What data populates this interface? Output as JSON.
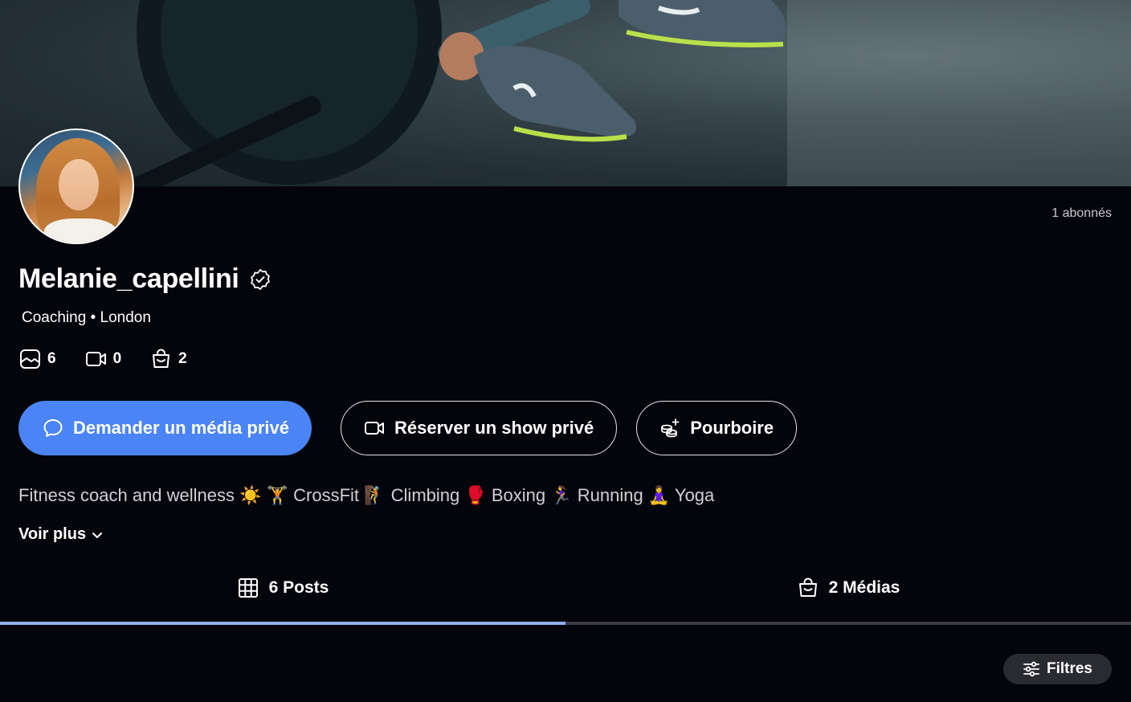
{
  "profile": {
    "username": "Melanie_capellini",
    "category": "Coaching",
    "separator": "•",
    "location": "London",
    "subscribers": "1 abonnés",
    "bio": "Fitness coach and wellness ☀️ 🏋️ CrossFit 🧗 Climbing 🥊 Boxing 🏃‍♀️ Running 🧘‍♀️ Yoga",
    "see_more": "Voir plus"
  },
  "counts": {
    "posts": "6",
    "videos": "0",
    "media": "2"
  },
  "actions": {
    "request_media": "Demander un média privé",
    "book_show": "Réserver un show privé",
    "tip": "Pourboire"
  },
  "tabs": [
    {
      "label": "6 Posts",
      "active": true
    },
    {
      "label": "2 Médias",
      "active": false
    }
  ],
  "filters": {
    "label": "Filtres"
  },
  "colors": {
    "primary": "#4a84f5",
    "background": "#04050a",
    "active_tab_indicator": "#8fb1f5"
  }
}
